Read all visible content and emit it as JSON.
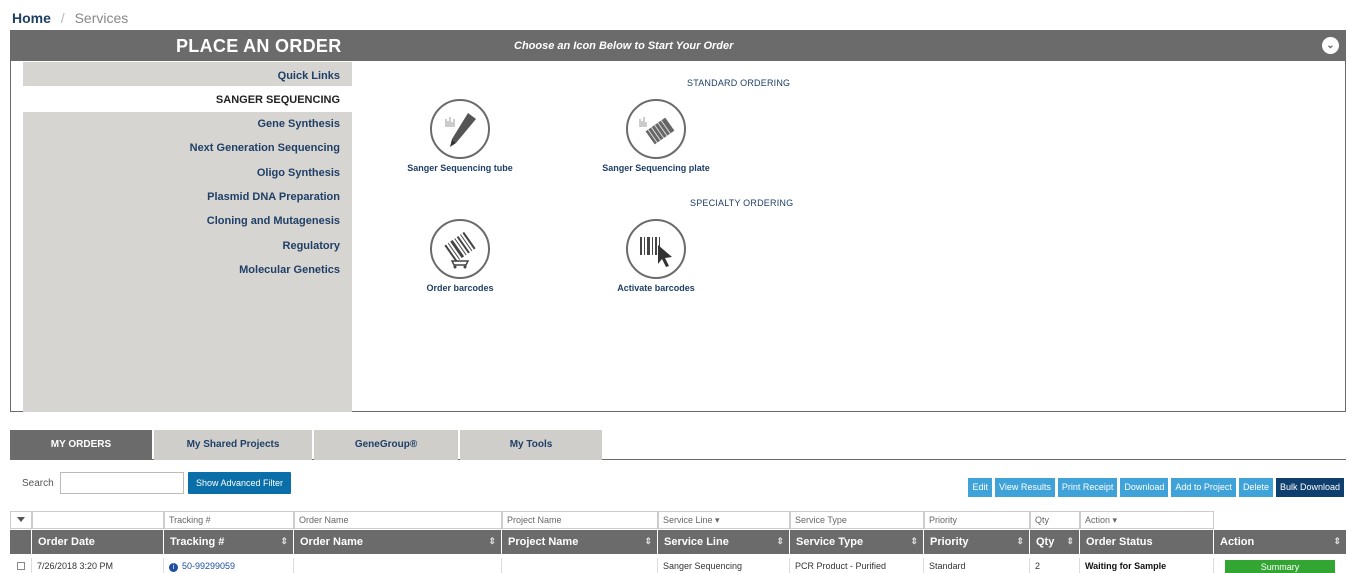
{
  "breadcrumb": {
    "home": "Home",
    "separator": "/",
    "current": "Services"
  },
  "order_panel": {
    "title": "PLACE AN ORDER",
    "subtitle": "Choose an Icon Below to Start Your Order",
    "toggle_icon": "chevron-down-icon",
    "sidebar": [
      {
        "label": "Quick Links"
      },
      {
        "label": "SANGER SEQUENCING",
        "active": true
      },
      {
        "label": "Gene Synthesis"
      },
      {
        "label": "Next Generation Sequencing"
      },
      {
        "label": "Oligo Synthesis"
      },
      {
        "label": "Plasmid DNA Preparation"
      },
      {
        "label": "Cloning and Mutagenesis"
      },
      {
        "label": "Regulatory"
      },
      {
        "label": "Molecular Genetics"
      }
    ],
    "standard_label": "STANDARD ORDERING",
    "specialty_label": "SPECIALTY ORDERING",
    "tiles": [
      {
        "label": "Sanger Sequencing tube",
        "icon": "sequencing-tube-icon"
      },
      {
        "label": "Sanger Sequencing plate",
        "icon": "sequencing-plate-icon"
      },
      {
        "label": "Order barcodes",
        "icon": "barcode-cart-icon"
      },
      {
        "label": "Activate barcodes",
        "icon": "barcode-cursor-icon"
      }
    ]
  },
  "tabs": [
    {
      "label": "MY ORDERS",
      "active": true
    },
    {
      "label": "My Shared Projects"
    },
    {
      "label": "GeneGroup®"
    },
    {
      "label": "My Tools"
    }
  ],
  "search": {
    "label": "Search",
    "value": "",
    "advanced_button": "Show Advanced Filter"
  },
  "actions": [
    "Edit",
    "View Results",
    "Print Receipt",
    "Download",
    "Add to Project",
    "Delete",
    "Bulk Download"
  ],
  "table": {
    "filters": [
      "",
      "Tracking #",
      "Order Name",
      "Project Name",
      "Service Line ▾",
      "Service Type",
      "Priority",
      "Qty",
      "Action ▾"
    ],
    "headers": [
      "Order Date",
      "Tracking #",
      "Order Name",
      "Project Name",
      "Service Line",
      "Service Type",
      "Priority",
      "Qty",
      "Order Status",
      "Action"
    ],
    "rows": [
      {
        "order_date": "7/26/2018 3:20 PM",
        "tracking": "50-99299059",
        "order_name": "",
        "project_name": "",
        "service_line": "Sanger Sequencing",
        "service_type": "PCR Product - Purified",
        "priority": "Standard",
        "qty": "2",
        "status": "Waiting for Sample",
        "action": "Summary"
      }
    ]
  },
  "colors": {
    "header_gray": "#6b6b6b",
    "nav_blue": "#1f3f66",
    "action_blue": "#3fa3d9",
    "summary_green": "#33a532"
  }
}
